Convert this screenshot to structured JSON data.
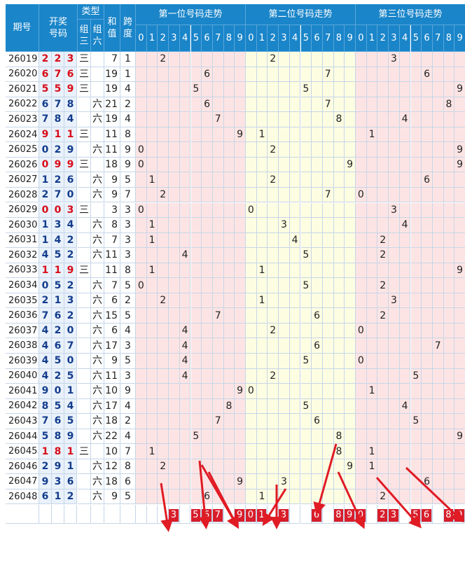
{
  "header": {
    "issue": "期号",
    "draw": [
      "开奖",
      "号码"
    ],
    "type": "类型",
    "type_sub": [
      [
        "组",
        "三"
      ],
      [
        "组",
        "六"
      ]
    ],
    "sum": [
      "和",
      "值"
    ],
    "span": [
      "跨",
      "度"
    ],
    "sections": [
      "第一位号码走势",
      "第二位号码走势",
      "第三位号码走势"
    ],
    "digits": [
      "0",
      "1",
      "2",
      "3",
      "4",
      "5",
      "6",
      "7",
      "8",
      "9"
    ]
  },
  "rows": [
    {
      "issue": "26019",
      "d": [
        2,
        2,
        3
      ],
      "g3": "三",
      "g6": "",
      "sum": "7",
      "span": "1"
    },
    {
      "issue": "26020",
      "d": [
        6,
        7,
        6
      ],
      "g3": "三",
      "g6": "",
      "sum": "19",
      "span": "1"
    },
    {
      "issue": "26021",
      "d": [
        5,
        5,
        9
      ],
      "g3": "三",
      "g6": "",
      "sum": "19",
      "span": "4"
    },
    {
      "issue": "26022",
      "d": [
        6,
        7,
        8
      ],
      "g3": "",
      "g6": "六",
      "sum": "21",
      "span": "2"
    },
    {
      "issue": "26023",
      "d": [
        7,
        8,
        4
      ],
      "g3": "",
      "g6": "六",
      "sum": "19",
      "span": "4"
    },
    {
      "issue": "26024",
      "d": [
        9,
        1,
        1
      ],
      "g3": "三",
      "g6": "",
      "sum": "11",
      "span": "8"
    },
    {
      "issue": "26025",
      "d": [
        0,
        2,
        9
      ],
      "g3": "",
      "g6": "六",
      "sum": "11",
      "span": "9"
    },
    {
      "issue": "26026",
      "d": [
        0,
        9,
        9
      ],
      "g3": "三",
      "g6": "",
      "sum": "18",
      "span": "9"
    },
    {
      "issue": "26027",
      "d": [
        1,
        2,
        6
      ],
      "g3": "",
      "g6": "六",
      "sum": "9",
      "span": "5"
    },
    {
      "issue": "26028",
      "d": [
        2,
        7,
        0
      ],
      "g3": "",
      "g6": "六",
      "sum": "9",
      "span": "7"
    },
    {
      "issue": "26029",
      "d": [
        0,
        0,
        3
      ],
      "g3": "三",
      "g6": "",
      "sum": "3",
      "span": "3"
    },
    {
      "issue": "26030",
      "d": [
        1,
        3,
        4
      ],
      "g3": "",
      "g6": "六",
      "sum": "8",
      "span": "3"
    },
    {
      "issue": "26031",
      "d": [
        1,
        4,
        2
      ],
      "g3": "",
      "g6": "六",
      "sum": "7",
      "span": "3"
    },
    {
      "issue": "26032",
      "d": [
        4,
        5,
        2
      ],
      "g3": "",
      "g6": "六",
      "sum": "11",
      "span": "3"
    },
    {
      "issue": "26033",
      "d": [
        1,
        1,
        9
      ],
      "g3": "三",
      "g6": "",
      "sum": "11",
      "span": "8"
    },
    {
      "issue": "26034",
      "d": [
        0,
        5,
        2
      ],
      "g3": "",
      "g6": "六",
      "sum": "7",
      "span": "5"
    },
    {
      "issue": "26035",
      "d": [
        2,
        1,
        3
      ],
      "g3": "",
      "g6": "六",
      "sum": "6",
      "span": "2"
    },
    {
      "issue": "26036",
      "d": [
        7,
        6,
        2
      ],
      "g3": "",
      "g6": "六",
      "sum": "15",
      "span": "5"
    },
    {
      "issue": "26037",
      "d": [
        4,
        2,
        0
      ],
      "g3": "",
      "g6": "六",
      "sum": "6",
      "span": "4"
    },
    {
      "issue": "26038",
      "d": [
        4,
        6,
        7
      ],
      "g3": "",
      "g6": "六",
      "sum": "17",
      "span": "3"
    },
    {
      "issue": "26039",
      "d": [
        4,
        5,
        0
      ],
      "g3": "",
      "g6": "六",
      "sum": "9",
      "span": "5"
    },
    {
      "issue": "26040",
      "d": [
        4,
        2,
        5
      ],
      "g3": "",
      "g6": "六",
      "sum": "11",
      "span": "3"
    },
    {
      "issue": "26041",
      "d": [
        9,
        0,
        1
      ],
      "g3": "",
      "g6": "六",
      "sum": "10",
      "span": "9"
    },
    {
      "issue": "26042",
      "d": [
        8,
        5,
        4
      ],
      "g3": "",
      "g6": "六",
      "sum": "17",
      "span": "4"
    },
    {
      "issue": "26043",
      "d": [
        7,
        6,
        5
      ],
      "g3": "",
      "g6": "六",
      "sum": "18",
      "span": "2"
    },
    {
      "issue": "26044",
      "d": [
        5,
        8,
        9
      ],
      "g3": "",
      "g6": "六",
      "sum": "22",
      "span": "4"
    },
    {
      "issue": "26045",
      "d": [
        1,
        8,
        1
      ],
      "g3": "三",
      "g6": "",
      "sum": "10",
      "span": "7"
    },
    {
      "issue": "26046",
      "d": [
        2,
        9,
        1
      ],
      "g3": "",
      "g6": "六",
      "sum": "12",
      "span": "8"
    },
    {
      "issue": "26047",
      "d": [
        9,
        3,
        6
      ],
      "g3": "",
      "g6": "六",
      "sum": "18",
      "span": "6"
    },
    {
      "issue": "26048",
      "d": [
        6,
        1,
        2
      ],
      "g3": "",
      "g6": "六",
      "sum": "9",
      "span": "5"
    }
  ],
  "prediction": [
    [
      "3",
      "5",
      "6",
      "7",
      "9"
    ],
    [
      "0",
      "1",
      "3",
      "6",
      "8",
      "9"
    ],
    [
      "0",
      "2",
      "3",
      "5",
      "6",
      "8",
      "9"
    ]
  ],
  "colors": {
    "header": "#1a85c9",
    "red": "#d80c18",
    "blue": "#123c8c",
    "pink": "#fde4e4",
    "yellow": "#fdfde2",
    "mark": "#d81d2b"
  }
}
